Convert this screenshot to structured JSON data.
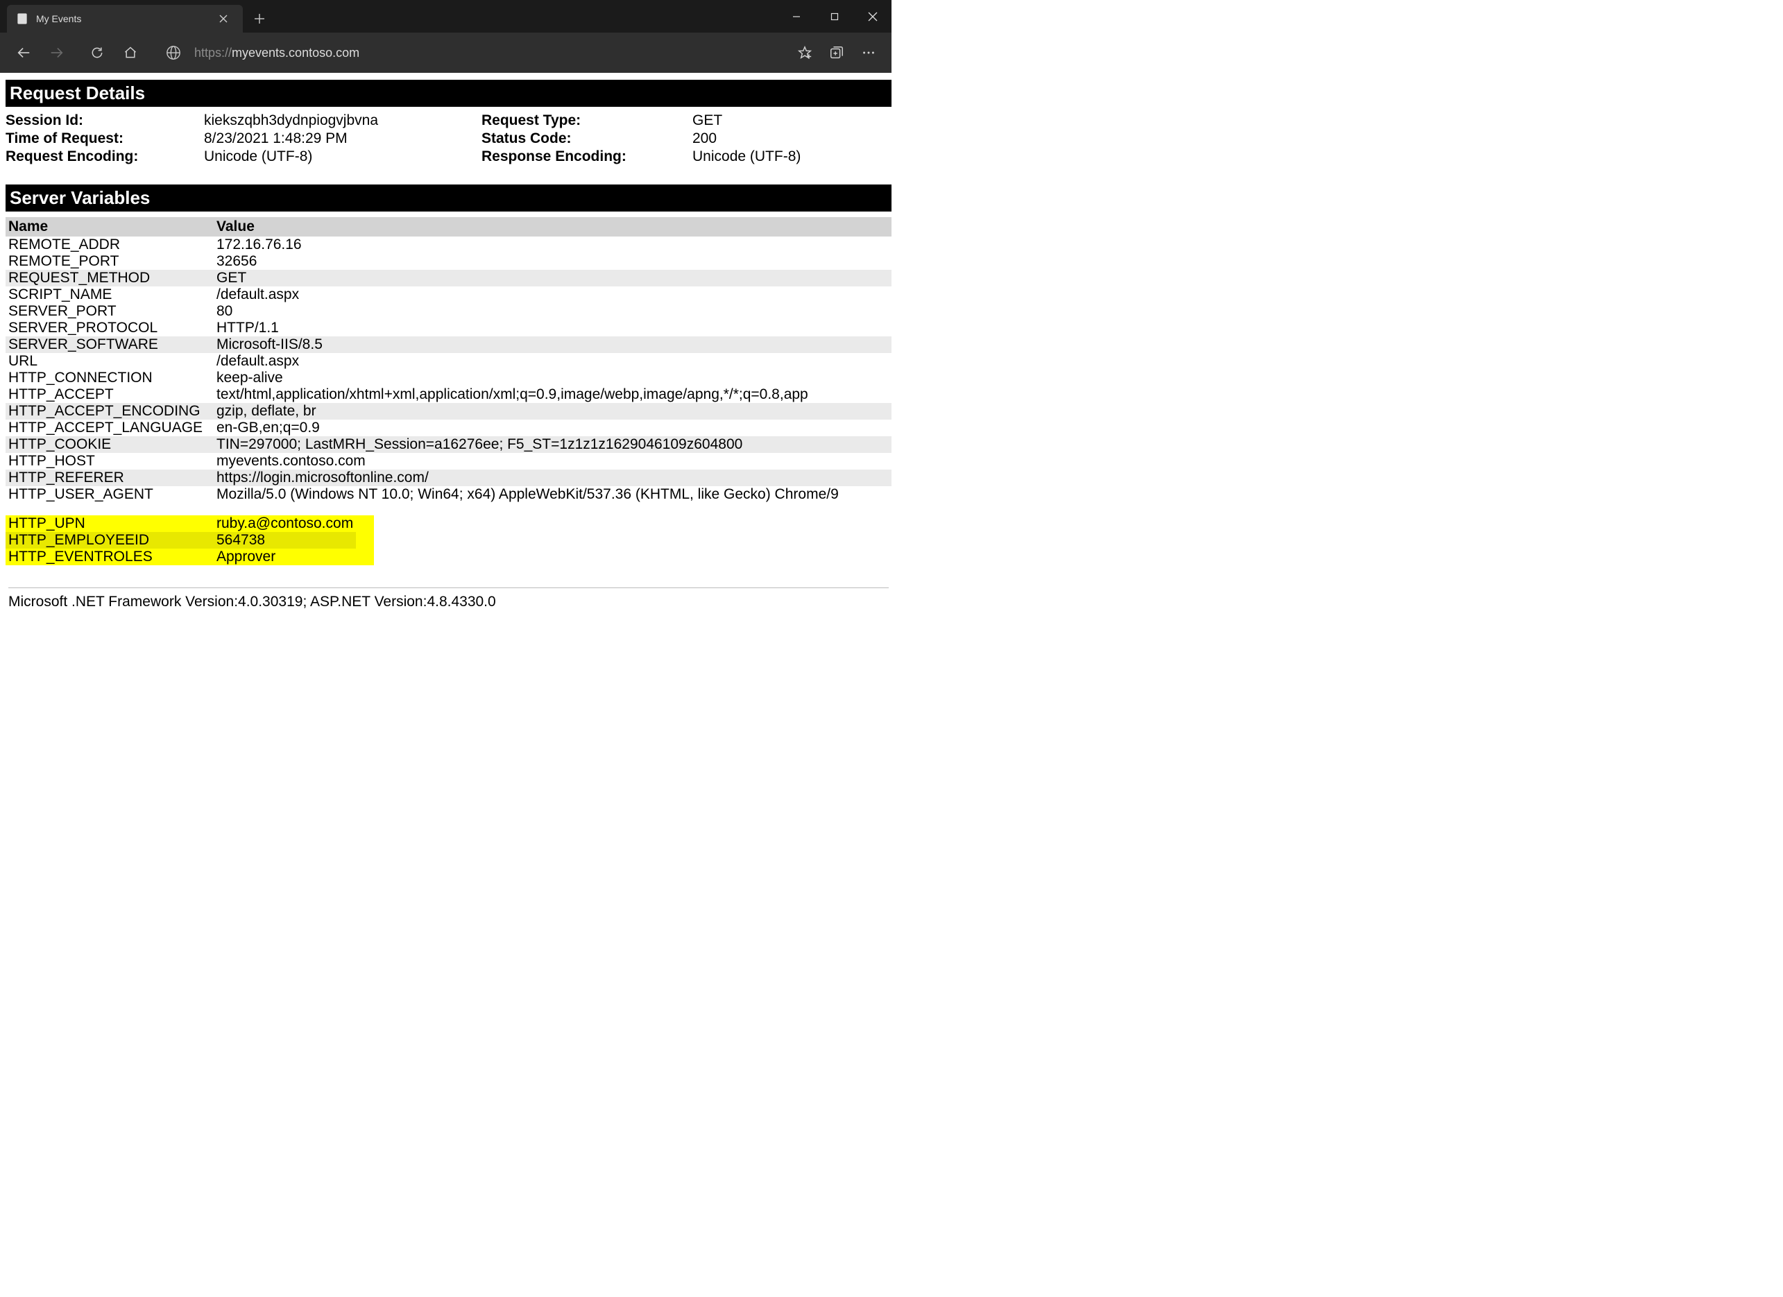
{
  "browser": {
    "tab_title": "My Events",
    "url_scheme": "https://",
    "url_host": "myevents.contoso.com"
  },
  "request_details": {
    "header": "Request Details",
    "labels": {
      "session_id": "Session Id:",
      "time": "Time of Request:",
      "req_encoding": "Request Encoding:",
      "req_type": "Request Type:",
      "status": "Status Code:",
      "resp_encoding": "Response Encoding:"
    },
    "session_id": "kiekszqbh3dydnpiogvjbvna",
    "time": "8/23/2021 1:48:29 PM",
    "req_encoding": "Unicode (UTF-8)",
    "req_type": "GET",
    "status": "200",
    "resp_encoding": "Unicode (UTF-8)"
  },
  "server_vars": {
    "header": "Server Variables",
    "col_name": "Name",
    "col_value": "Value",
    "rows": [
      {
        "name": "REMOTE_ADDR",
        "value": "172.16.76.16",
        "alt": false
      },
      {
        "name": "REMOTE_PORT",
        "value": "32656",
        "alt": false
      },
      {
        "name": "REQUEST_METHOD",
        "value": "GET",
        "alt": true
      },
      {
        "name": "SCRIPT_NAME",
        "value": "/default.aspx",
        "alt": false
      },
      {
        "name": "SERVER_PORT",
        "value": "80",
        "alt": false
      },
      {
        "name": "SERVER_PROTOCOL",
        "value": "HTTP/1.1",
        "alt": false
      },
      {
        "name": "SERVER_SOFTWARE",
        "value": "Microsoft-IIS/8.5",
        "alt": true
      },
      {
        "name": "URL",
        "value": "/default.aspx",
        "alt": false
      },
      {
        "name": "HTTP_CONNECTION",
        "value": "keep-alive",
        "alt": false
      },
      {
        "name": "HTTP_ACCEPT",
        "value": "text/html,application/xhtml+xml,application/xml;q=0.9,image/webp,image/apng,*/*;q=0.8,app",
        "alt": false
      },
      {
        "name": "HTTP_ACCEPT_ENCODING",
        "value": "gzip, deflate, br",
        "alt": true
      },
      {
        "name": "HTTP_ACCEPT_LANGUAGE",
        "value": "en-GB,en;q=0.9",
        "alt": false
      },
      {
        "name": "HTTP_COOKIE",
        "value": "TIN=297000; LastMRH_Session=a16276ee; F5_ST=1z1z1z1629046109z604800",
        "alt": true
      },
      {
        "name": "HTTP_HOST",
        "value": "myevents.contoso.com",
        "alt": false
      },
      {
        "name": "HTTP_REFERER",
        "value": "https://login.microsoftonline.com/",
        "alt": true
      },
      {
        "name": "HTTP_USER_AGENT",
        "value": "Mozilla/5.0 (Windows NT 10.0; Win64; x64) AppleWebKit/537.36 (KHTML, like Gecko) Chrome/9",
        "alt": false
      }
    ],
    "highlighted": [
      {
        "name": "HTTP_UPN",
        "value": "ruby.a@contoso.com",
        "alt": false
      },
      {
        "name": "HTTP_EMPLOYEEID",
        "value": "564738",
        "alt": true
      },
      {
        "name": "HTTP_EVENTROLES",
        "value": "Approver",
        "alt": false
      }
    ]
  },
  "footer": "Microsoft .NET Framework Version:4.0.30319; ASP.NET Version:4.8.4330.0"
}
